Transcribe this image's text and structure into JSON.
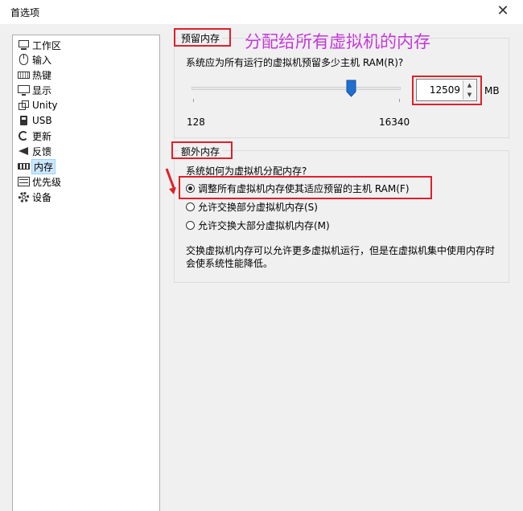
{
  "window": {
    "title": "首选项",
    "close_glyph": "✕"
  },
  "sidebar": {
    "items": [
      {
        "label": "工作区",
        "icon": "workspace-icon"
      },
      {
        "label": "输入",
        "icon": "mouse-icon"
      },
      {
        "label": "热键",
        "icon": "keyboard-icon"
      },
      {
        "label": "显示",
        "icon": "monitor-icon"
      },
      {
        "label": "Unity",
        "icon": "unity-icon"
      },
      {
        "label": "USB",
        "icon": "usb-icon"
      },
      {
        "label": "更新",
        "icon": "refresh-icon"
      },
      {
        "label": "反馈",
        "icon": "megaphone-icon"
      },
      {
        "label": "内存",
        "icon": "memory-icon",
        "selected": true
      },
      {
        "label": "优先级",
        "icon": "priority-icon"
      },
      {
        "label": "设备",
        "icon": "device-gear-icon"
      }
    ]
  },
  "annotation": {
    "text": "分配给所有虚拟机的内存",
    "color": "#c535d8"
  },
  "reserved": {
    "legend": "预留内存",
    "question": "系统应为所有运行的虚拟机预留多少主机 RAM(R)?",
    "slider": {
      "min_label": "128",
      "max_label": "16340",
      "min": 128,
      "max": 16340,
      "value": 12509
    },
    "spin_value": "12509",
    "unit": "MB"
  },
  "extra": {
    "legend": "额外内存",
    "question": "系统如何为虚拟机分配内存?",
    "options": [
      {
        "label": "调整所有虚拟机内存使其适应预留的主机 RAM(F)",
        "selected": true
      },
      {
        "label": "允许交换部分虚拟机内存(S)",
        "selected": false
      },
      {
        "label": "允许交换大部分虚拟机内存(M)",
        "selected": false
      }
    ],
    "description": "交换虚拟机内存可以允许更多虚拟机运行，但是在虚拟机集中使用内存时会使系统性能降低。"
  },
  "colors": {
    "highlight_box": "#e0202a",
    "selection": "#cce8ff",
    "thumb": "#1f6fd1"
  }
}
